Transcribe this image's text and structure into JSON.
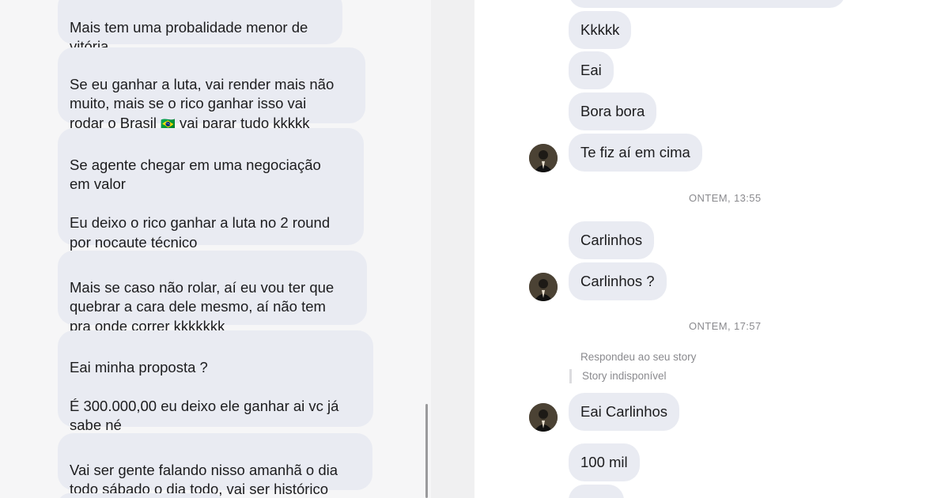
{
  "left_chat": {
    "messages": [
      {
        "text": "Mais tem uma probalidade menor de\nvitória",
        "emoji": "🎖"
      },
      {
        "text": "Se eu ganhar a luta, vai render mais não\nmuito, mais se o rico ganhar isso vai\nrodar o Brasil ",
        "emoji": "🇧🇷",
        "text_after": " vai parar tudo kkkkk"
      },
      {
        "text": "Se agente chegar em uma negociação\nem valor\n\nEu deixo o rico ganhar a luta no 2 round\npor nocaute técnico"
      },
      {
        "text": "Mais se caso não rolar, aí eu vou ter que\nquebrar a cara dele mesmo, aí não tem\npra onde correr kkkkkkk"
      },
      {
        "text": "Eai minha proposta ?\n\nÉ 300.000,00 eu deixo ele ganhar ai vc já\nsabe né"
      },
      {
        "text": "Vai ser gente falando nisso amanhã o dia\ntodo sábado o dia todo, vai ser histórico"
      }
    ]
  },
  "right_chat": {
    "messages": [
      {
        "text": "Kkkkk"
      },
      {
        "text": "Eai"
      },
      {
        "text": "Bora bora"
      },
      {
        "text": "Te fiz aí em cima"
      },
      {
        "text": "Carlinhos"
      },
      {
        "text": "Carlinhos ?"
      },
      {
        "text": "Eai Carlinhos"
      },
      {
        "text": "100 mil"
      }
    ],
    "timestamps": [
      "ONTEM, 13:55",
      "ONTEM, 17:57"
    ],
    "story_reply": {
      "label": "Respondeu ao seu story",
      "quoted": "Story indisponível"
    }
  },
  "colors": {
    "bubble": "#e9ebf2",
    "text": "#1c1c1e",
    "meta": "#8a8a8e"
  }
}
